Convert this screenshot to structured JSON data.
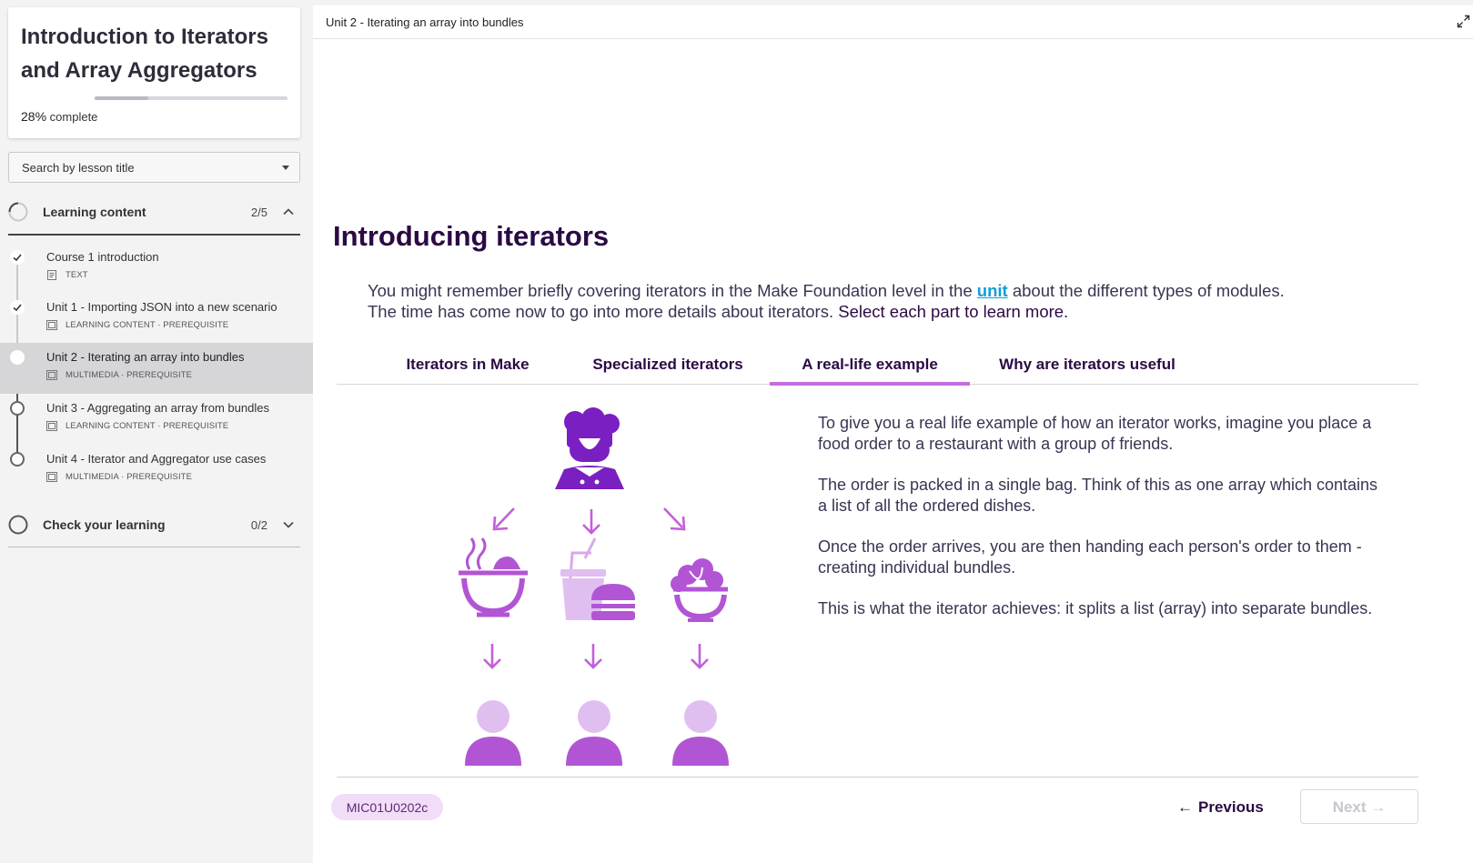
{
  "sidebar": {
    "course_title": "Introduction to Iterators and Array Aggregators",
    "progress_percent": "28%",
    "progress_suffix": "complete",
    "progress_value": 0.28,
    "search_placeholder": "Search by lesson title",
    "sections": [
      {
        "label": "Learning content",
        "count": "2/5",
        "expanded": true,
        "lessons": [
          {
            "title": "Course 1 introduction",
            "type": "TEXT",
            "status": "done",
            "icon": "document-icon"
          },
          {
            "title": "Unit 1 - Importing JSON into a new scenario",
            "type": "LEARNING CONTENT · PREREQUISITE",
            "status": "done",
            "icon": "media-icon"
          },
          {
            "title": "Unit 2 - Iterating an array into bundles",
            "type": "MULTIMEDIA · PREREQUISITE",
            "status": "current",
            "icon": "media-icon"
          },
          {
            "title": "Unit 3 - Aggregating an array from bundles",
            "type": "LEARNING CONTENT · PREREQUISITE",
            "status": "todo",
            "icon": "media-icon"
          },
          {
            "title": "Unit 4 - Iterator and Aggregator use cases",
            "type": "MULTIMEDIA · PREREQUISITE",
            "status": "todo",
            "icon": "media-icon"
          }
        ]
      },
      {
        "label": "Check your learning",
        "count": "0/2",
        "expanded": false
      }
    ]
  },
  "main": {
    "breadcrumb": "Unit 2 - Iterating an array into bundles",
    "heading": "Introducing iterators",
    "intro": {
      "before_link": "You might remember briefly covering iterators in the Make Foundation level in the ",
      "link": "unit",
      "after_link": " about the different types of modules. The time has come now to go into more details about iterators. ",
      "strong": "Select each part to learn more."
    },
    "tabs": [
      {
        "label": "Iterators in Make",
        "active": false
      },
      {
        "label": "Specialized iterators",
        "active": false
      },
      {
        "label": "A real-life example",
        "active": true
      },
      {
        "label": "Why are iterators useful",
        "active": false
      }
    ],
    "panel_paragraphs": [
      "To give you a real life example of how an iterator works, imagine you place a food order to a restaurant with a group of friends.",
      "The order is packed in a single bag. Think of this as one array which contains a list of all the ordered dishes.",
      "Once the order arrives, you are then handing each person's order to them - creating individual bundles.",
      "This is what the iterator achieves: it splits a list (array) into separate bundles."
    ],
    "illustration_icons": [
      "chef-icon",
      "soup-bowl-icon",
      "drink-burger-icon",
      "salad-bowl-icon",
      "person-icon"
    ],
    "code_badge": "MIC01U0202c",
    "previous_label": "Previous",
    "next_label": "Next"
  },
  "colors": {
    "accent_purple": "#c76ce0",
    "dark_purple": "#2b0a44",
    "link_blue": "#0e9fd8",
    "icon_purple": "#7a1fc2",
    "icon_light": "#e0bff0"
  }
}
